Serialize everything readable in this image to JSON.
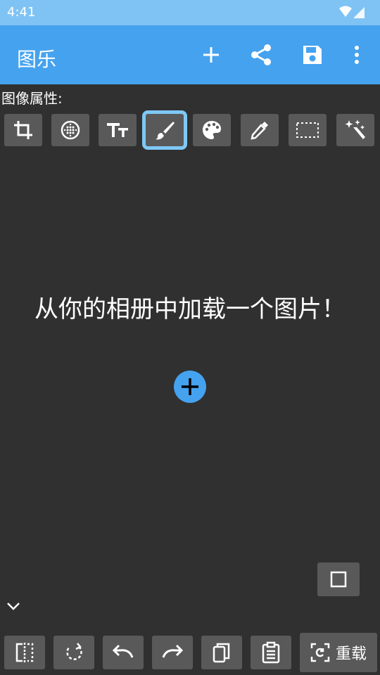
{
  "status_bar": {
    "time": "4:41"
  },
  "app_bar": {
    "title": "图乐",
    "actions": [
      "add-icon",
      "share-icon",
      "save-icon",
      "more-vert-icon"
    ]
  },
  "toolbar": {
    "label": "图像属性:",
    "tools": [
      {
        "icon": "crop-icon",
        "selected": false
      },
      {
        "icon": "dotted-circle-icon",
        "selected": false
      },
      {
        "icon": "text-size-icon",
        "selected": false
      },
      {
        "icon": "brush-icon",
        "selected": true
      },
      {
        "icon": "palette-icon",
        "selected": false
      },
      {
        "icon": "eyedropper-icon",
        "selected": false
      },
      {
        "icon": "select-rect-icon",
        "selected": false
      },
      {
        "icon": "magic-wand-icon",
        "selected": false
      }
    ]
  },
  "canvas": {
    "empty_message": "从你的相册中加载一个图片！"
  },
  "bottom_bar": {
    "buttons": [
      "flip-icon",
      "rotate-icon",
      "undo-icon",
      "redo-icon",
      "copy-icon",
      "clipboard-icon"
    ],
    "reload_label": "重载"
  },
  "colors": {
    "app_bar": "#45a2ef",
    "status_bar": "#7fc3f4",
    "background": "#303030",
    "button": "#595959",
    "selection": "#7fc8f6"
  }
}
